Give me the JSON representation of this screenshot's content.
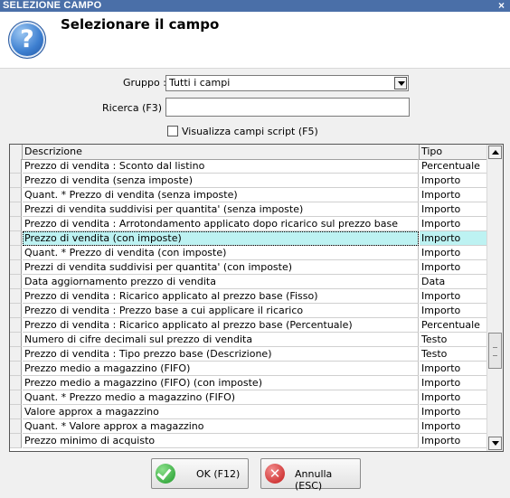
{
  "window": {
    "title": "SELEZIONE CAMPO",
    "close_glyph": "×"
  },
  "header": {
    "title": "Selezionare il campo",
    "icon": "question-icon"
  },
  "form": {
    "group_label": "Gruppo :",
    "group_value": "Tutti i campi",
    "search_label": "Ricerca (F3) :",
    "search_value": "",
    "script_checkbox_label": "Visualizza campi script (F5)",
    "script_checkbox_checked": false
  },
  "grid": {
    "columns": [
      "Descrizione",
      "Tipo"
    ],
    "selected_index": 5,
    "rows": [
      {
        "desc": "Prezzo di vendita : Sconto dal listino",
        "type": "Percentuale"
      },
      {
        "desc": "Prezzo di vendita (senza imposte)",
        "type": "Importo"
      },
      {
        "desc": "Quant. * Prezzo di vendita (senza imposte)",
        "type": "Importo"
      },
      {
        "desc": "Prezzi di vendita suddivisi per quantita' (senza imposte)",
        "type": "Importo"
      },
      {
        "desc": "Prezzo di vendita : Arrotondamento applicato dopo ricarico sul prezzo base",
        "type": "Importo"
      },
      {
        "desc": "Prezzo di vendita (con imposte)",
        "type": "Importo"
      },
      {
        "desc": "Quant. * Prezzo di vendita (con imposte)",
        "type": "Importo"
      },
      {
        "desc": "Prezzi di vendita suddivisi per quantita' (con imposte)",
        "type": "Importo"
      },
      {
        "desc": "Data aggiornamento prezzo di vendita",
        "type": "Data"
      },
      {
        "desc": "Prezzo di vendita : Ricarico applicato al prezzo base (Fisso)",
        "type": "Importo"
      },
      {
        "desc": "Prezzo di vendita : Prezzo base a cui applicare il ricarico",
        "type": "Importo"
      },
      {
        "desc": "Prezzo di vendita : Ricarico applicato al prezzo base (Percentuale)",
        "type": "Percentuale"
      },
      {
        "desc": "Numero di cifre decimali sul prezzo di vendita",
        "type": "Testo"
      },
      {
        "desc": "Prezzo di vendita : Tipo prezzo base (Descrizione)",
        "type": "Testo"
      },
      {
        "desc": "Prezzo medio a magazzino (FIFO)",
        "type": "Importo"
      },
      {
        "desc": "Prezzo medio a magazzino (FIFO) (con imposte)",
        "type": "Importo"
      },
      {
        "desc": "Quant. * Prezzo medio a magazzino (FIFO)",
        "type": "Importo"
      },
      {
        "desc": "Valore approx a magazzino",
        "type": "Importo"
      },
      {
        "desc": "Quant. * Valore approx a magazzino",
        "type": "Importo"
      },
      {
        "desc": "Prezzo minimo di acquisto",
        "type": "Importo"
      }
    ]
  },
  "buttons": {
    "ok": "OK (F12)",
    "cancel": "Annulla (ESC)"
  }
}
